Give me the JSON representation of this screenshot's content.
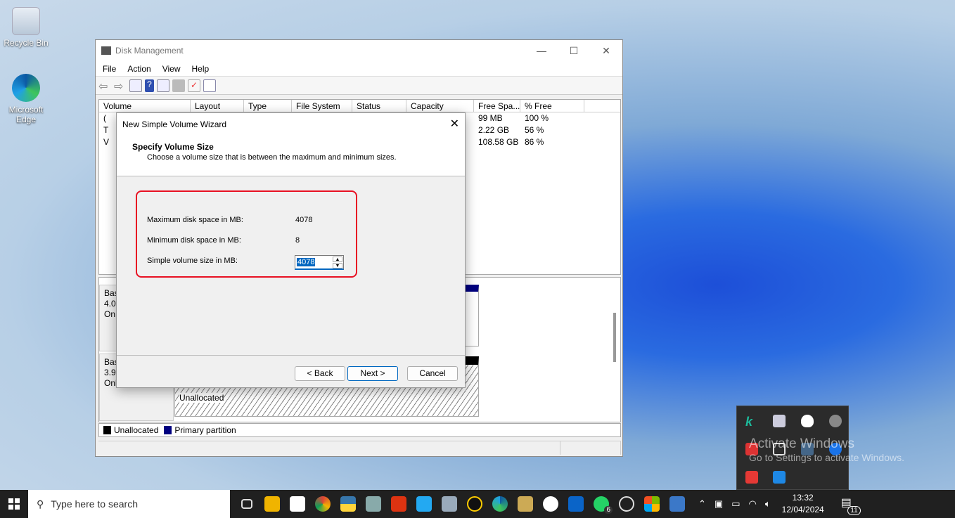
{
  "desktop": {
    "icons": [
      {
        "label": "Recycle Bin",
        "icon": "recycle-bin-icon"
      },
      {
        "label": "Microsoft Edge",
        "icon": "edge-icon"
      }
    ],
    "watermark": {
      "title": "Activate Windows",
      "subtitle": "Go to Settings to activate Windows."
    }
  },
  "window": {
    "title": "Disk Management",
    "menu": [
      "File",
      "Action",
      "View",
      "Help"
    ],
    "columns": [
      "Volume",
      "Layout",
      "Type",
      "File System",
      "Status",
      "Capacity",
      "Free Spa...",
      "% Free"
    ],
    "rows": [
      {
        "volume": "(",
        "free": "99 MB",
        "pct": "100 %"
      },
      {
        "volume": "T",
        "free": "2.22 GB",
        "pct": "56 %"
      },
      {
        "volume": "V",
        "free": "108.58 GB",
        "pct": "86 %"
      }
    ],
    "disks": [
      {
        "l1": "Bas",
        "l2": "4.0",
        "l3": "On"
      },
      {
        "l1": "Bas",
        "l2": "3.9",
        "l3": "Online"
      }
    ],
    "unallocated_label": "Unallocated",
    "legend": [
      {
        "label": "Unallocated",
        "color": "#000000"
      },
      {
        "label": "Primary partition",
        "color": "#000080"
      }
    ]
  },
  "wizard": {
    "title": "New Simple Volume Wizard",
    "heading": "Specify Volume Size",
    "subheading": "Choose a volume size that is between the maximum and minimum sizes.",
    "max_label": "Maximum disk space in MB:",
    "max_value": "4078",
    "min_label": "Minimum disk space in MB:",
    "min_value": "8",
    "size_label": "Simple volume size in MB:",
    "size_value": "4078",
    "back": "< Back",
    "next": "Next >",
    "cancel": "Cancel",
    "highlight_color": "#e81123"
  },
  "taskbar": {
    "search_placeholder": "Type here to search",
    "time": "13:32",
    "date": "12/04/2024",
    "whatsapp_badge": "6",
    "notifications": "11"
  }
}
